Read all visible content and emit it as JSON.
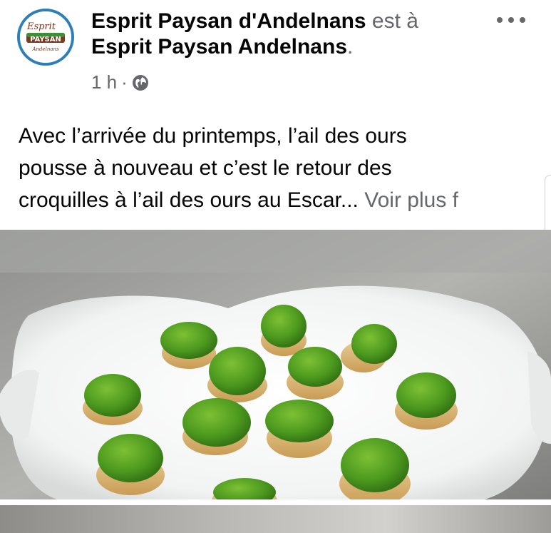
{
  "post": {
    "author": "Esprit Paysan d'Andelnans",
    "connector": "est à",
    "location": "Esprit Paysan Andelnans",
    "location_suffix": ".",
    "time": "1 h",
    "separator": "·",
    "audience_icon": "globe-icon",
    "avatar_logo": {
      "line1": "Esprit",
      "line2": "PAYSAN",
      "line3": "Andelnans"
    },
    "text_lines": [
      "Avec l’arrivée du printemps, l’ail des ours",
      "pousse à nouveau et c’est le retour des",
      "croquilles à l’ail des ours au Escar..."
    ],
    "see_more": "Voir plus f"
  },
  "colors": {
    "text_primary": "#050505",
    "text_secondary": "#65676b",
    "avatar_ring": "#2e7fb8",
    "logo_green": "#3f8f3a",
    "logo_brown": "#7a3a20"
  },
  "icons": {
    "more": "more-horizontal-icon"
  }
}
